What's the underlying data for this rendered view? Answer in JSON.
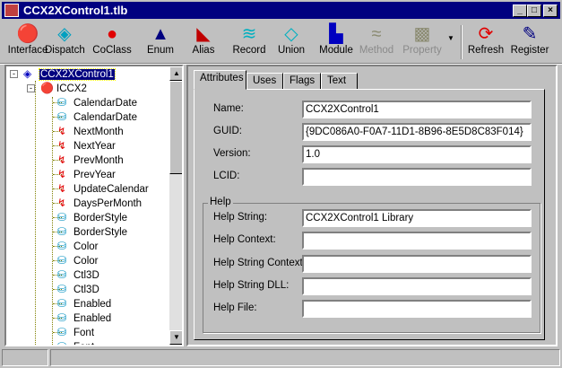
{
  "window": {
    "title": "CCX2XControl1.tlb",
    "min": "_",
    "max": "□",
    "close": "×"
  },
  "toolbar": [
    {
      "label": "Interface",
      "icon": "interface-icon",
      "glyph": "🔴",
      "color": "#e00000",
      "enabled": true
    },
    {
      "label": "Dispatch",
      "icon": "dispatch-icon",
      "glyph": "◈",
      "color": "#00a0c0",
      "enabled": true
    },
    {
      "label": "CoClass",
      "icon": "coclass-icon",
      "glyph": "●",
      "color": "#e00000",
      "enabled": true
    },
    {
      "label": "Enum",
      "icon": "enum-icon",
      "glyph": "▲",
      "color": "#000080",
      "enabled": true
    },
    {
      "label": "Alias",
      "icon": "alias-icon",
      "glyph": "◣",
      "color": "#c00000",
      "enabled": true
    },
    {
      "label": "Record",
      "icon": "record-icon",
      "glyph": "≋",
      "color": "#00b0c0",
      "enabled": true
    },
    {
      "label": "Union",
      "icon": "union-icon",
      "glyph": "◇",
      "color": "#00b0c0",
      "enabled": true
    },
    {
      "label": "Module",
      "icon": "module-icon",
      "glyph": "▙",
      "color": "#0000c0",
      "enabled": true
    },
    {
      "label": "Method",
      "icon": "method-icon",
      "glyph": "≈",
      "color": "#8a8a70",
      "enabled": false
    },
    {
      "label": "Property",
      "icon": "property-icon",
      "glyph": "▩",
      "color": "#8a8a70",
      "enabled": false
    },
    {
      "label": "Refresh",
      "icon": "refresh-icon",
      "glyph": "⟳",
      "color": "#e00000",
      "enabled": true
    },
    {
      "label": "Register",
      "icon": "register-icon",
      "glyph": "✎",
      "color": "#000080",
      "enabled": true
    }
  ],
  "tree": {
    "root": "CCX2XControl1",
    "interface": "ICCX2",
    "items": [
      {
        "label": "CalendarDate",
        "kind": "prop-get"
      },
      {
        "label": "CalendarDate",
        "kind": "prop-put"
      },
      {
        "label": "NextMonth",
        "kind": "method"
      },
      {
        "label": "NextYear",
        "kind": "method"
      },
      {
        "label": "PrevMonth",
        "kind": "method"
      },
      {
        "label": "PrevYear",
        "kind": "method"
      },
      {
        "label": "UpdateCalendar",
        "kind": "method"
      },
      {
        "label": "DaysPerMonth",
        "kind": "method"
      },
      {
        "label": "BorderStyle",
        "kind": "prop-get"
      },
      {
        "label": "BorderStyle",
        "kind": "prop-put"
      },
      {
        "label": "Color",
        "kind": "prop-get"
      },
      {
        "label": "Color",
        "kind": "prop-put"
      },
      {
        "label": "Ctl3D",
        "kind": "prop-get"
      },
      {
        "label": "Ctl3D",
        "kind": "prop-put"
      },
      {
        "label": "Enabled",
        "kind": "prop-get"
      },
      {
        "label": "Enabled",
        "kind": "prop-put"
      },
      {
        "label": "Font",
        "kind": "prop-get"
      },
      {
        "label": "Font",
        "kind": "prop-put"
      }
    ]
  },
  "tabs": [
    "Attributes",
    "Uses",
    "Flags",
    "Text"
  ],
  "fields": [
    {
      "label": "Name:",
      "value": "CCX2XControl1"
    },
    {
      "label": "GUID:",
      "value": "{9DC086A0-F0A7-11D1-8B96-8E5D8C83F014}"
    },
    {
      "label": "Version:",
      "value": "1.0"
    },
    {
      "label": "LCID:",
      "value": ""
    }
  ],
  "help": {
    "title": "Help",
    "fields": [
      {
        "label": "Help String:",
        "value": "CCX2XControl1 Library"
      },
      {
        "label": "Help Context:",
        "value": ""
      },
      {
        "label": "Help String Context:",
        "value": ""
      },
      {
        "label": "Help String DLL:",
        "value": ""
      },
      {
        "label": "Help File:",
        "value": ""
      }
    ]
  }
}
